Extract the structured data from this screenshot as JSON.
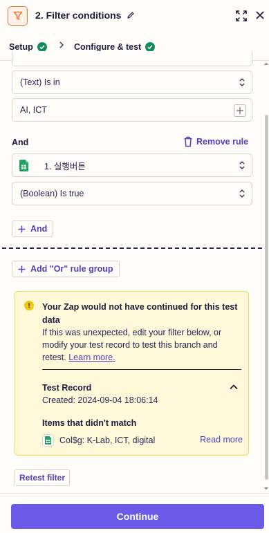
{
  "header": {
    "title": "2. Filter conditions",
    "icon": "filter-icon",
    "accent": "#f0742d"
  },
  "tabs": [
    {
      "label": "Setup",
      "complete": true
    },
    {
      "label": "Configure & test",
      "complete": true,
      "active": true
    }
  ],
  "rule_group_1": {
    "condition_1": {
      "operator": "(Text) Is in",
      "value": "AI, ICT"
    },
    "and_label": "And",
    "remove_rule_label": "Remove rule",
    "condition_2": {
      "field": "1. 실행버튼",
      "operator": "(Boolean) Is true"
    },
    "and_button_label": "And"
  },
  "or_group_button_label": "Add \"Or\" rule group",
  "warning": {
    "title_line1": "Your Zap would not have continued for this test",
    "title_line2": "data",
    "body_line1": "If this was unexpected, edit your filter below, or",
    "body_line2": "modify your test record to test this branch and",
    "body_line3_prefix": "retest. ",
    "learn_more": "Learn more.",
    "record_title": "Test Record",
    "record_created": "Created: 2024-09-04 18:06:14",
    "items_title": "Items that didn't match",
    "item_text": "Col$g: K-Lab, ICT, digital",
    "read_more": "Read more"
  },
  "retest_label": "Retest filter",
  "continue_label": "Continue",
  "colors": {
    "primary": "#695be8",
    "link": "#503ebd",
    "success": "#168a5c",
    "warning_bg": "#fff9d9",
    "warning_border": "#f2d84a"
  }
}
